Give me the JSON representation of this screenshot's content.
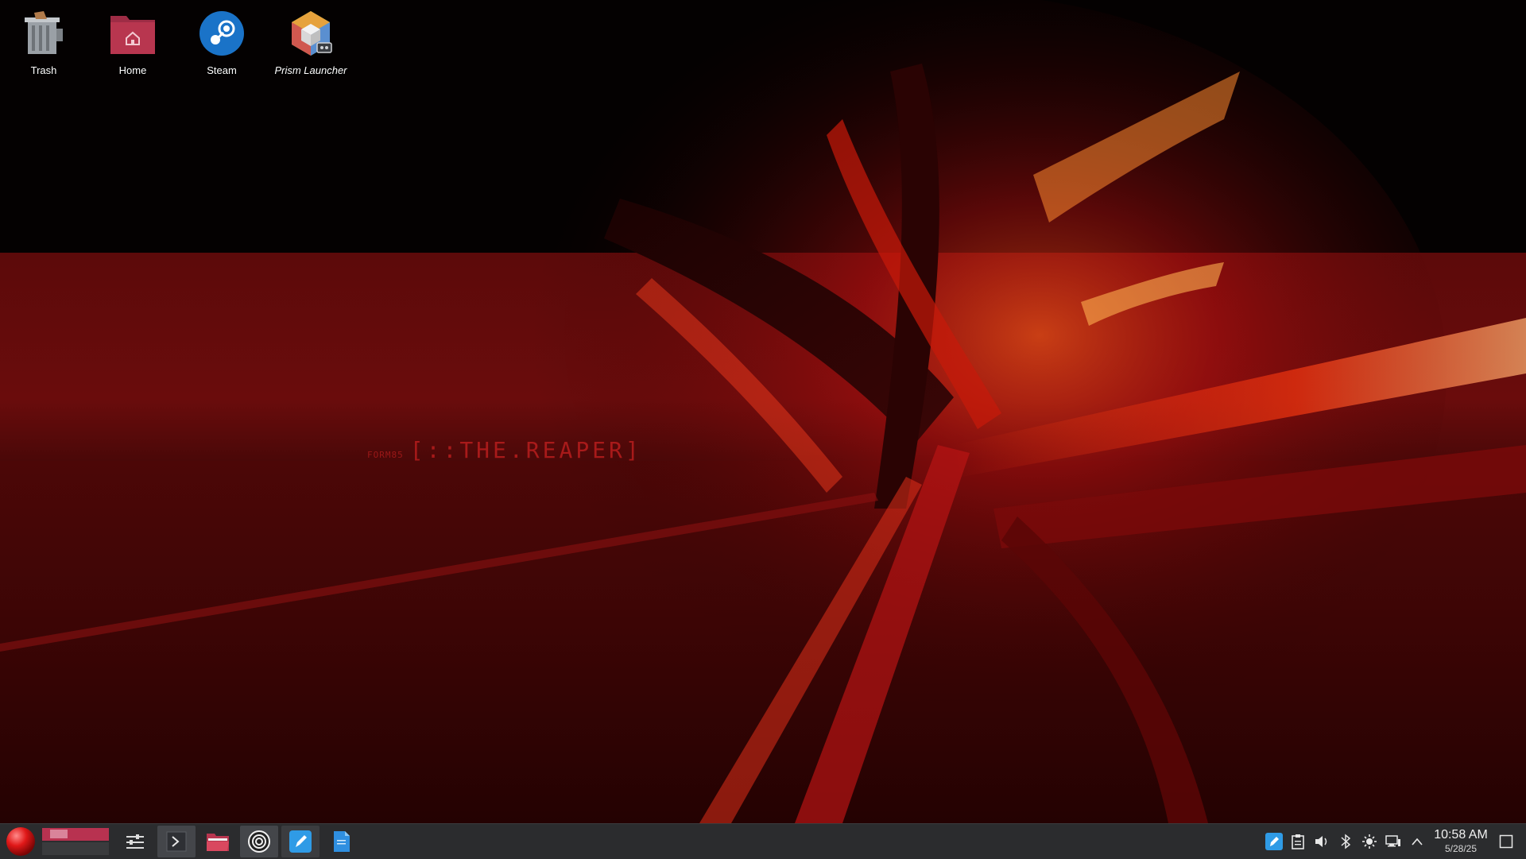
{
  "desktop": {
    "icons": [
      {
        "label": "Trash",
        "icon": "trash-icon"
      },
      {
        "label": "Home",
        "icon": "home-folder-icon"
      },
      {
        "label": "Steam",
        "icon": "steam-icon"
      },
      {
        "label": "Prism Launcher",
        "icon": "prism-launcher-icon"
      }
    ]
  },
  "wallpaper": {
    "small_text": "FORM85",
    "title_text": "[::THE.REAPER]"
  },
  "taskbar": {
    "launcher_icon": "application-launcher-icon",
    "tasks": [
      {
        "name": "system-settings-icon"
      },
      {
        "name": "terminal-icon"
      },
      {
        "name": "file-manager-icon"
      },
      {
        "name": "obs-studio-icon"
      },
      {
        "name": "text-editor-icon"
      },
      {
        "name": "document-viewer-icon"
      }
    ],
    "tray": [
      {
        "name": "text-editor-tray-icon"
      },
      {
        "name": "clipboard-icon"
      },
      {
        "name": "volume-icon"
      },
      {
        "name": "bluetooth-icon"
      },
      {
        "name": "brightness-icon"
      },
      {
        "name": "network-icon"
      },
      {
        "name": "show-hidden-icons-icon"
      }
    ],
    "clock": {
      "time": "10:58 AM",
      "date": "5/28/25"
    },
    "show_desktop_icon": "show-desktop-icon"
  }
}
